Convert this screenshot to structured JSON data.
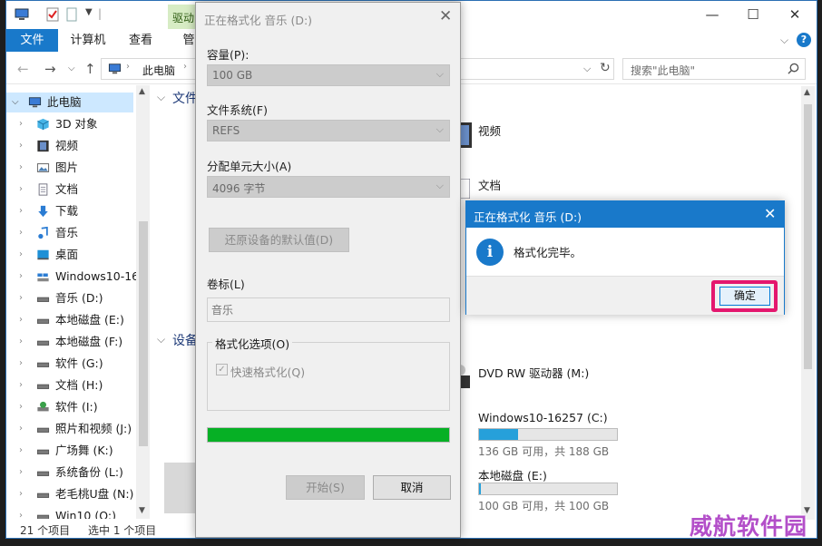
{
  "explorer": {
    "ribbon_context_tab": "驱动",
    "ribbon_partial_tab": "管",
    "tabs": [
      {
        "label": "文件",
        "active": true
      },
      {
        "label": "计算机",
        "active": false
      },
      {
        "label": "查看",
        "active": false
      }
    ],
    "address_path": "此电脑",
    "search_placeholder": "搜索\"此电脑\"",
    "sidebar": [
      {
        "label": "此电脑",
        "icon": "computer-icon",
        "selected": true,
        "expanded": true
      },
      {
        "label": "3D 对象",
        "icon": "cube-icon"
      },
      {
        "label": "视频",
        "icon": "video-icon"
      },
      {
        "label": "图片",
        "icon": "picture-icon"
      },
      {
        "label": "文档",
        "icon": "document-icon"
      },
      {
        "label": "下载",
        "icon": "download-icon"
      },
      {
        "label": "音乐",
        "icon": "music-icon"
      },
      {
        "label": "桌面",
        "icon": "desktop-icon"
      },
      {
        "label": "Windows10-16",
        "icon": "os-drive-icon"
      },
      {
        "label": "音乐 (D:)",
        "icon": "drive-icon"
      },
      {
        "label": "本地磁盘 (E:)",
        "icon": "drive-icon"
      },
      {
        "label": "本地磁盘 (F:)",
        "icon": "drive-icon"
      },
      {
        "label": "软件 (G:)",
        "icon": "drive-icon"
      },
      {
        "label": "文档 (H:)",
        "icon": "drive-icon"
      },
      {
        "label": "软件 (I:)",
        "icon": "software-drive-icon"
      },
      {
        "label": "照片和视频 (J:)",
        "icon": "drive-icon"
      },
      {
        "label": "广场舞 (K:)",
        "icon": "drive-icon"
      },
      {
        "label": "系统备份 (L:)",
        "icon": "drive-icon"
      },
      {
        "label": "老毛桃U盘 (N:)",
        "icon": "drive-icon"
      },
      {
        "label": "Win10 (O:)",
        "icon": "drive-icon"
      }
    ],
    "status_count": "21 个项目",
    "status_selected": "选中 1 个项目",
    "group_folders": "文件",
    "group_devices": "设备",
    "folders": [
      {
        "label": "视频",
        "icon": "video-icon"
      },
      {
        "label": "文档",
        "icon": "document-icon"
      }
    ],
    "dvd_label": "DVD RW 驱动器 (M:)",
    "drives": [
      {
        "label": "Windows10-16257 (C:)",
        "usage": "136 GB 可用，共 188 GB",
        "fill_fraction": 0.28
      },
      {
        "label": "本地磁盘 (E:)",
        "usage": "100 GB 可用，共 100 GB",
        "fill_fraction": 0.01
      }
    ]
  },
  "format_dialog": {
    "title": "正在格式化 音乐 (D:)",
    "capacity_label": "容量(P):",
    "capacity_value": "100 GB",
    "filesystem_label": "文件系统(F)",
    "filesystem_value": "REFS",
    "alloc_label": "分配单元大小(A)",
    "alloc_value": "4096 字节",
    "restore_defaults": "还原设备的默认值(D)",
    "volume_label": "卷标(L)",
    "volume_value": "音乐",
    "options_label": "格式化选项(O)",
    "quick_format": "快速格式化(Q)",
    "quick_format_checked": true,
    "progress_fraction": 1.0,
    "start_button": "开始(S)",
    "cancel_button": "取消"
  },
  "message_box": {
    "title": "正在格式化 音乐 (D:)",
    "message": "格式化完毕。",
    "ok_button": "确定"
  },
  "watermark": "威航软件园",
  "colors": {
    "accent": "#1979ca",
    "progress": "#06b025",
    "highlight": "#e4176e",
    "watermark": "#b34fc9"
  }
}
